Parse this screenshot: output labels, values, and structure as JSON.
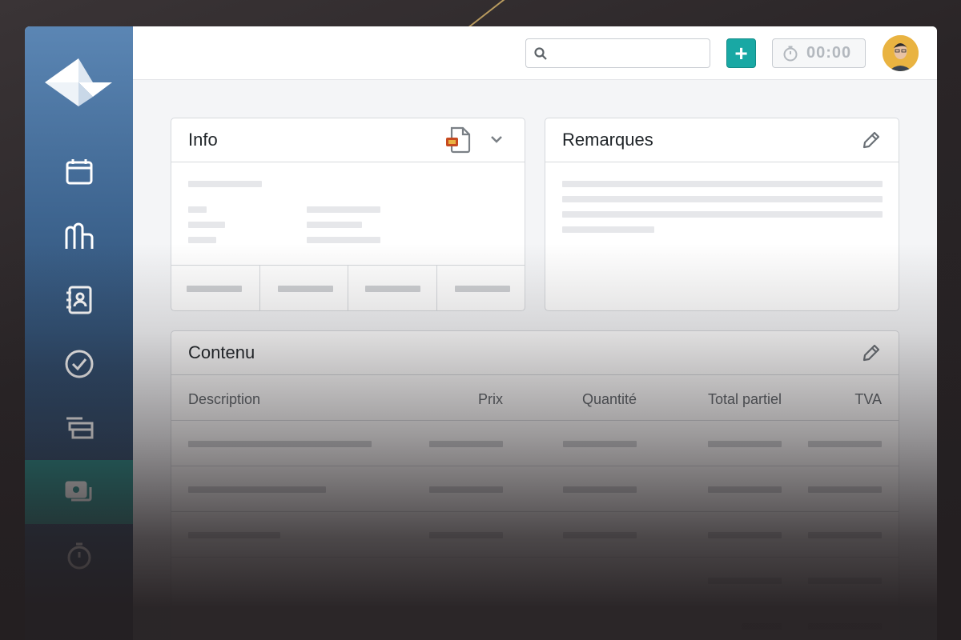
{
  "topbar": {
    "search_placeholder": "",
    "timer_value": "00:00",
    "add_label": "+"
  },
  "sidebar": {
    "items": [
      {
        "icon": "calendar-icon"
      },
      {
        "icon": "buildings-icon"
      },
      {
        "icon": "contacts-icon"
      },
      {
        "icon": "check-circle-icon"
      },
      {
        "icon": "stack-icon"
      },
      {
        "icon": "money-icon",
        "active": true
      },
      {
        "icon": "stopwatch-icon"
      }
    ]
  },
  "info": {
    "title": "Info"
  },
  "remarks": {
    "title": "Remarques"
  },
  "contents": {
    "title": "Contenu",
    "columns": [
      "Description",
      "Prix",
      "Quantité",
      "Total partiel",
      "TVA"
    ]
  },
  "colors": {
    "accent": "#19a8a4",
    "sidebar_top": "#5b86b4",
    "sidebar_bottom": "#223a57"
  }
}
